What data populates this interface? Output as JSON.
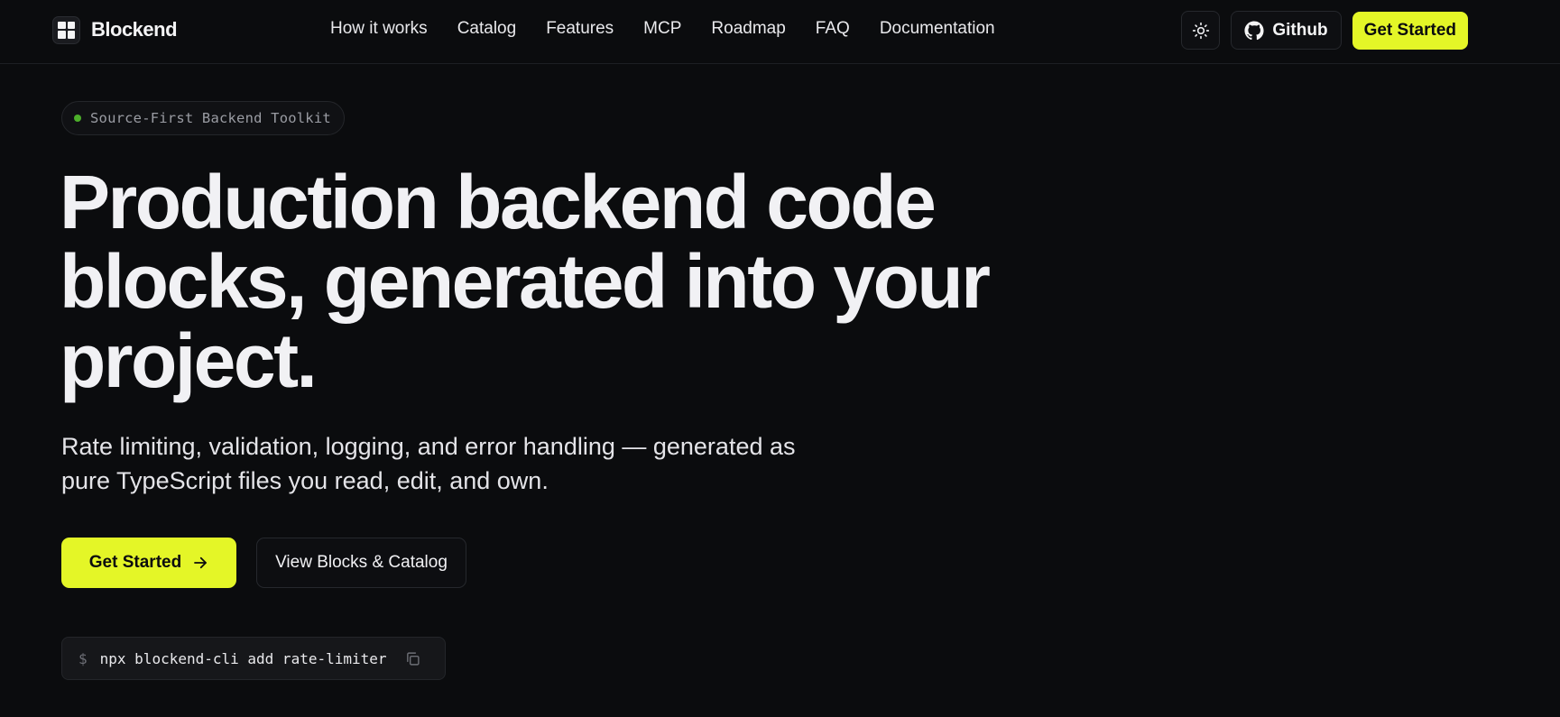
{
  "brand": {
    "name": "Blockend"
  },
  "nav": {
    "links": [
      "How it works",
      "Catalog",
      "Features",
      "MCP",
      "Roadmap",
      "FAQ",
      "Documentation"
    ],
    "github_label": "Github",
    "cta_label": "Get Started"
  },
  "hero": {
    "badge": "Source-First Backend Toolkit",
    "headline_lines": [
      "Production backend code",
      "blocks, generated into your",
      "project."
    ],
    "subtext_lines": [
      "Rate limiting, validation, logging, and error handling — generated as",
      "pure TypeScript files you read, edit, and own."
    ],
    "primary_button": "Get Started",
    "secondary_button": "View Blocks & Catalog",
    "command": {
      "prompt": "$",
      "text": "npx blockend-cli add rate-limiter"
    }
  },
  "colors": {
    "accent": "#e4f627",
    "background": "#0b0c0e",
    "badge_dot": "#4caf2a"
  },
  "icons": [
    "sun-icon",
    "github-icon",
    "arrow-right-icon",
    "copy-icon"
  ]
}
